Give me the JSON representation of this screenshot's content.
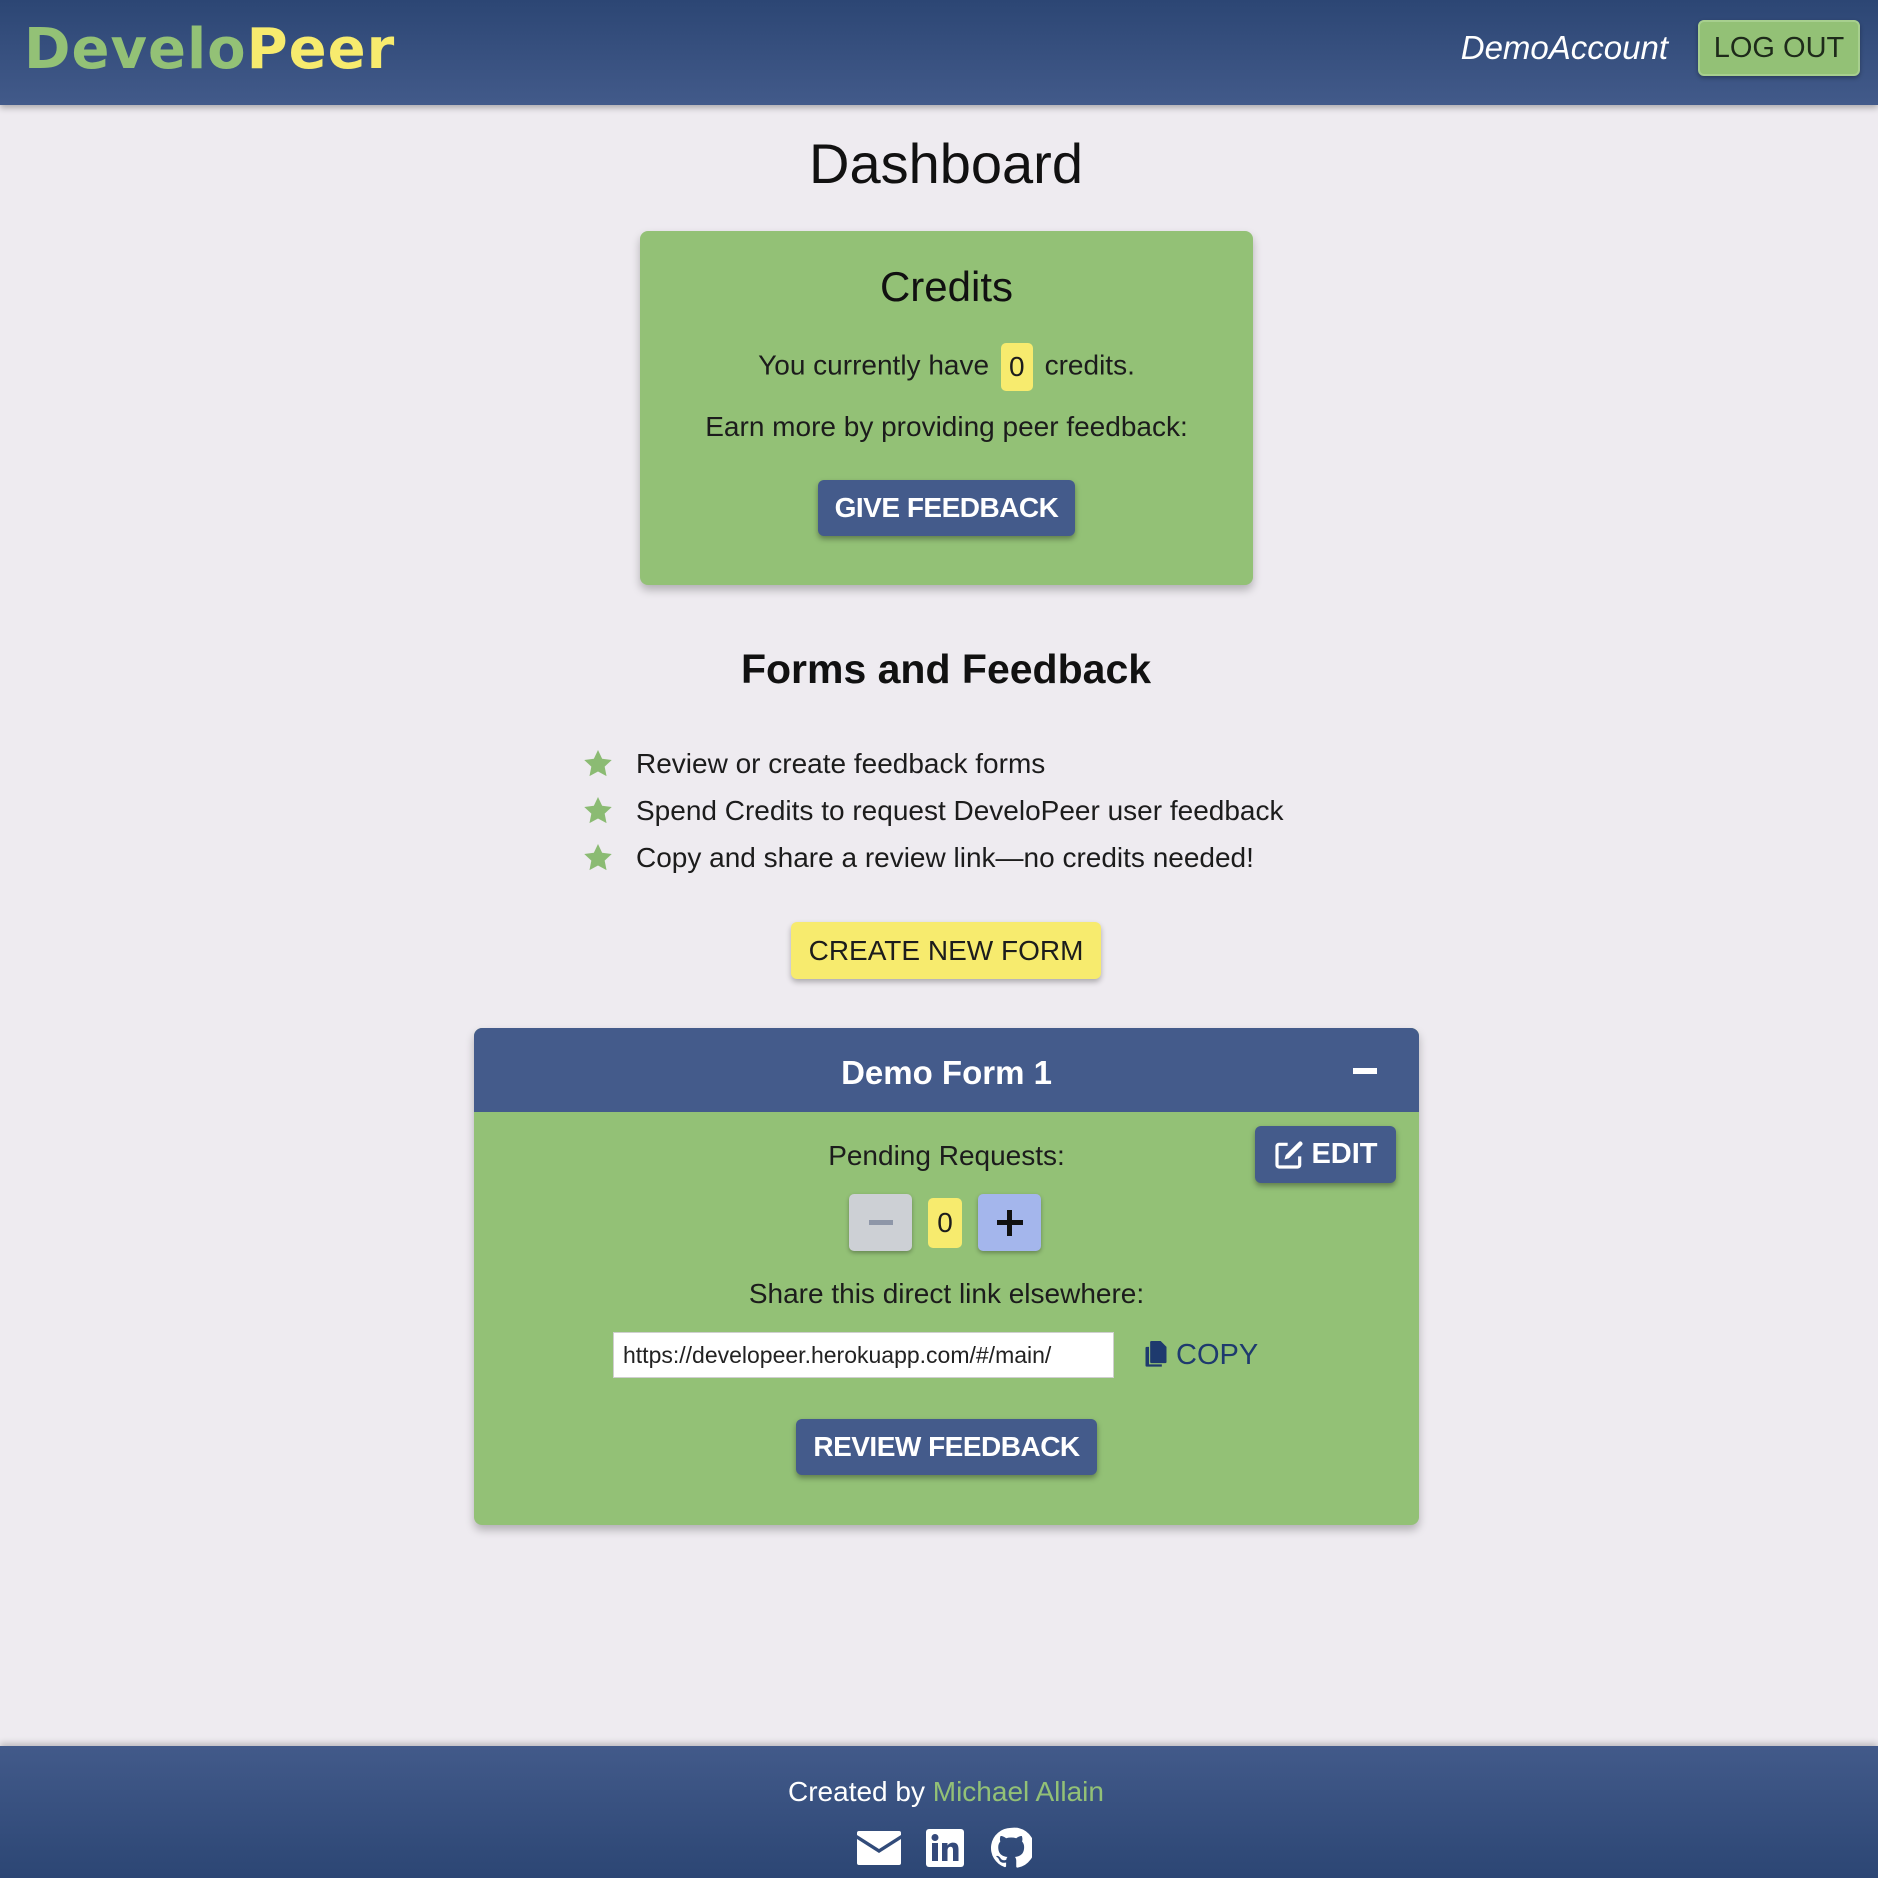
{
  "navbar": {
    "logo_part1": "Develo",
    "logo_part2": "Peer",
    "account_name": "DemoAccount",
    "logout_label": "LOG OUT"
  },
  "page": {
    "title": "Dashboard"
  },
  "credits": {
    "title": "Credits",
    "line_prefix": "You currently have",
    "count": "0",
    "line_suffix": "credits.",
    "earn_text": "Earn more by providing peer feedback:",
    "give_feedback_label": "GIVE FEEDBACK"
  },
  "forms_section": {
    "title": "Forms and Feedback",
    "features": [
      "Review or create feedback forms",
      "Spend Credits to request DeveloPeer user feedback",
      "Copy and share a review link—no credits needed!"
    ],
    "feature_icon": "star-icon",
    "create_label": "CREATE NEW FORM"
  },
  "form_card": {
    "name": "Demo Form 1",
    "collapse_icon": "minus-icon",
    "edit_label": "EDIT",
    "pending_label": "Pending Requests:",
    "pending_count": "0",
    "share_label": "Share this direct link elsewhere:",
    "share_link": "https://developeer.herokuapp.com/#/main/",
    "copy_label": "COPY",
    "review_label": "REVIEW FEEDBACK"
  },
  "footer": {
    "created_by": "Created by",
    "author": "Michael Allain",
    "icons": [
      "email-icon",
      "linkedin-icon",
      "github-icon"
    ]
  },
  "colors": {
    "navy": "#445b8b",
    "green": "#93c176",
    "yellow": "#f7eb6e",
    "background": "#eeebf0"
  }
}
